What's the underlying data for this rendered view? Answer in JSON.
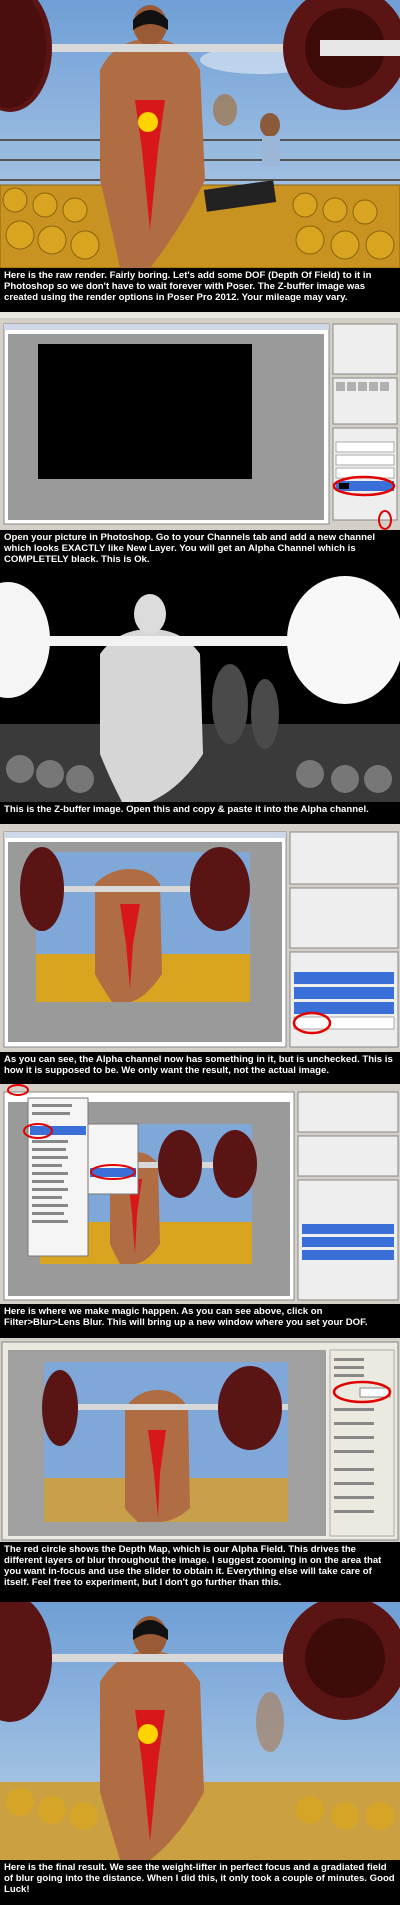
{
  "steps": [
    {
      "caption": "Here is the raw render.  Fairly boring.  Let's add some DOF (Depth Of Field) to it in Photoshop so we don't have to wait forever with Poser.  The Z-buffer image was created using the render options in Poser Pro 2012.  Your mileage may vary."
    },
    {
      "caption": "Open your picture in Photoshop.  Go to your Channels tab and add a new channel which looks EXACTLY like New Layer.  You will get an Alpha Channel which is COMPLETELY black.  This is Ok."
    },
    {
      "caption": "This is the Z-buffer image.  Open this and copy & paste it into the Alpha channel."
    },
    {
      "caption": "As you can see, the Alpha channel now has something in it, but is unchecked.  This is how it is supposed to be.  We only want the result, not the actual image."
    },
    {
      "caption": "Here is where we make magic happen.  As you can see above, click on Filter>Blur>Lens Blur.  This will bring up a new window where you set your DOF."
    },
    {
      "caption": "The red circle shows the Depth Map, which is our Alpha Field.  This drives the different layers of blur throughout the image.  I suggest zooming in on the area that you want in-focus and use the slider to obtain it.  Everything else will take care of itself.  Feel free to experiment, but I don't go further than this."
    },
    {
      "caption": "Here is the final result.  We see the weight-lifter in perfect focus and a gradiated field of blur going into the distance.  When I did this, it only took a couple of minutes.  Good Luck!"
    }
  ],
  "colors": {
    "sky": "#7fa8d8",
    "plate": "#5a1414",
    "bar": "#d8d8d8",
    "suit": "#d81818",
    "gold": "#d9a521",
    "caption_bg": "#000000",
    "caption_text": "#ffffff",
    "ps_bg": "#d4d0c8",
    "ps_canvas_bg": "#9a9a9a",
    "selection": "#3a6fd8",
    "circle": "#e00000"
  }
}
